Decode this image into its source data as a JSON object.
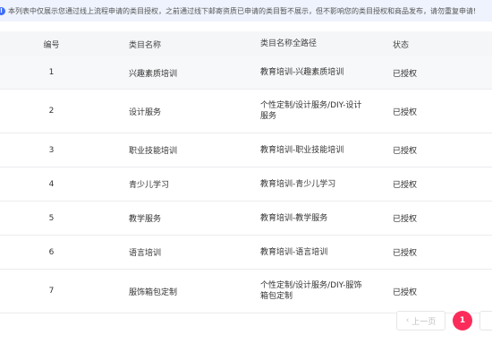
{
  "notice": {
    "icon": "info-icon",
    "text": "本列表中仅展示您通过线上流程申请的类目授权，之前通过线下邮寄资质已申请的类目暂不展示，但不影响您的类目授权和商品发布，请勿重复申请!"
  },
  "table": {
    "headers": [
      "编号",
      "类目名称",
      "类目名称全路径",
      "状态"
    ],
    "rows": [
      {
        "id": "1",
        "name": "兴趣素质培训",
        "path": "教育培训-兴趣素质培训",
        "status": "已授权"
      },
      {
        "id": "2",
        "name": "设计服务",
        "path": "个性定制/设计服务/DIY-设计服务",
        "status": "已授权"
      },
      {
        "id": "3",
        "name": "职业技能培训",
        "path": "教育培训-职业技能培训",
        "status": "已授权"
      },
      {
        "id": "4",
        "name": "青少儿学习",
        "path": "教育培训-青少儿学习",
        "status": "已授权"
      },
      {
        "id": "5",
        "name": "教学服务",
        "path": "教育培训-教学服务",
        "status": "已授权"
      },
      {
        "id": "6",
        "name": "语言培训",
        "path": "教育培训-语言培训",
        "status": "已授权"
      },
      {
        "id": "7",
        "name": "服饰箱包定制",
        "path": "个性定制/设计服务/DIY-服饰箱包定制",
        "status": "已授权"
      }
    ]
  },
  "pagination": {
    "prev_label": "上一页",
    "current_page": "1",
    "next_label": "下"
  },
  "colors": {
    "accent": "#fb2c5a",
    "notice_bg": "#eef3fd",
    "info_icon": "#3f6df6"
  }
}
